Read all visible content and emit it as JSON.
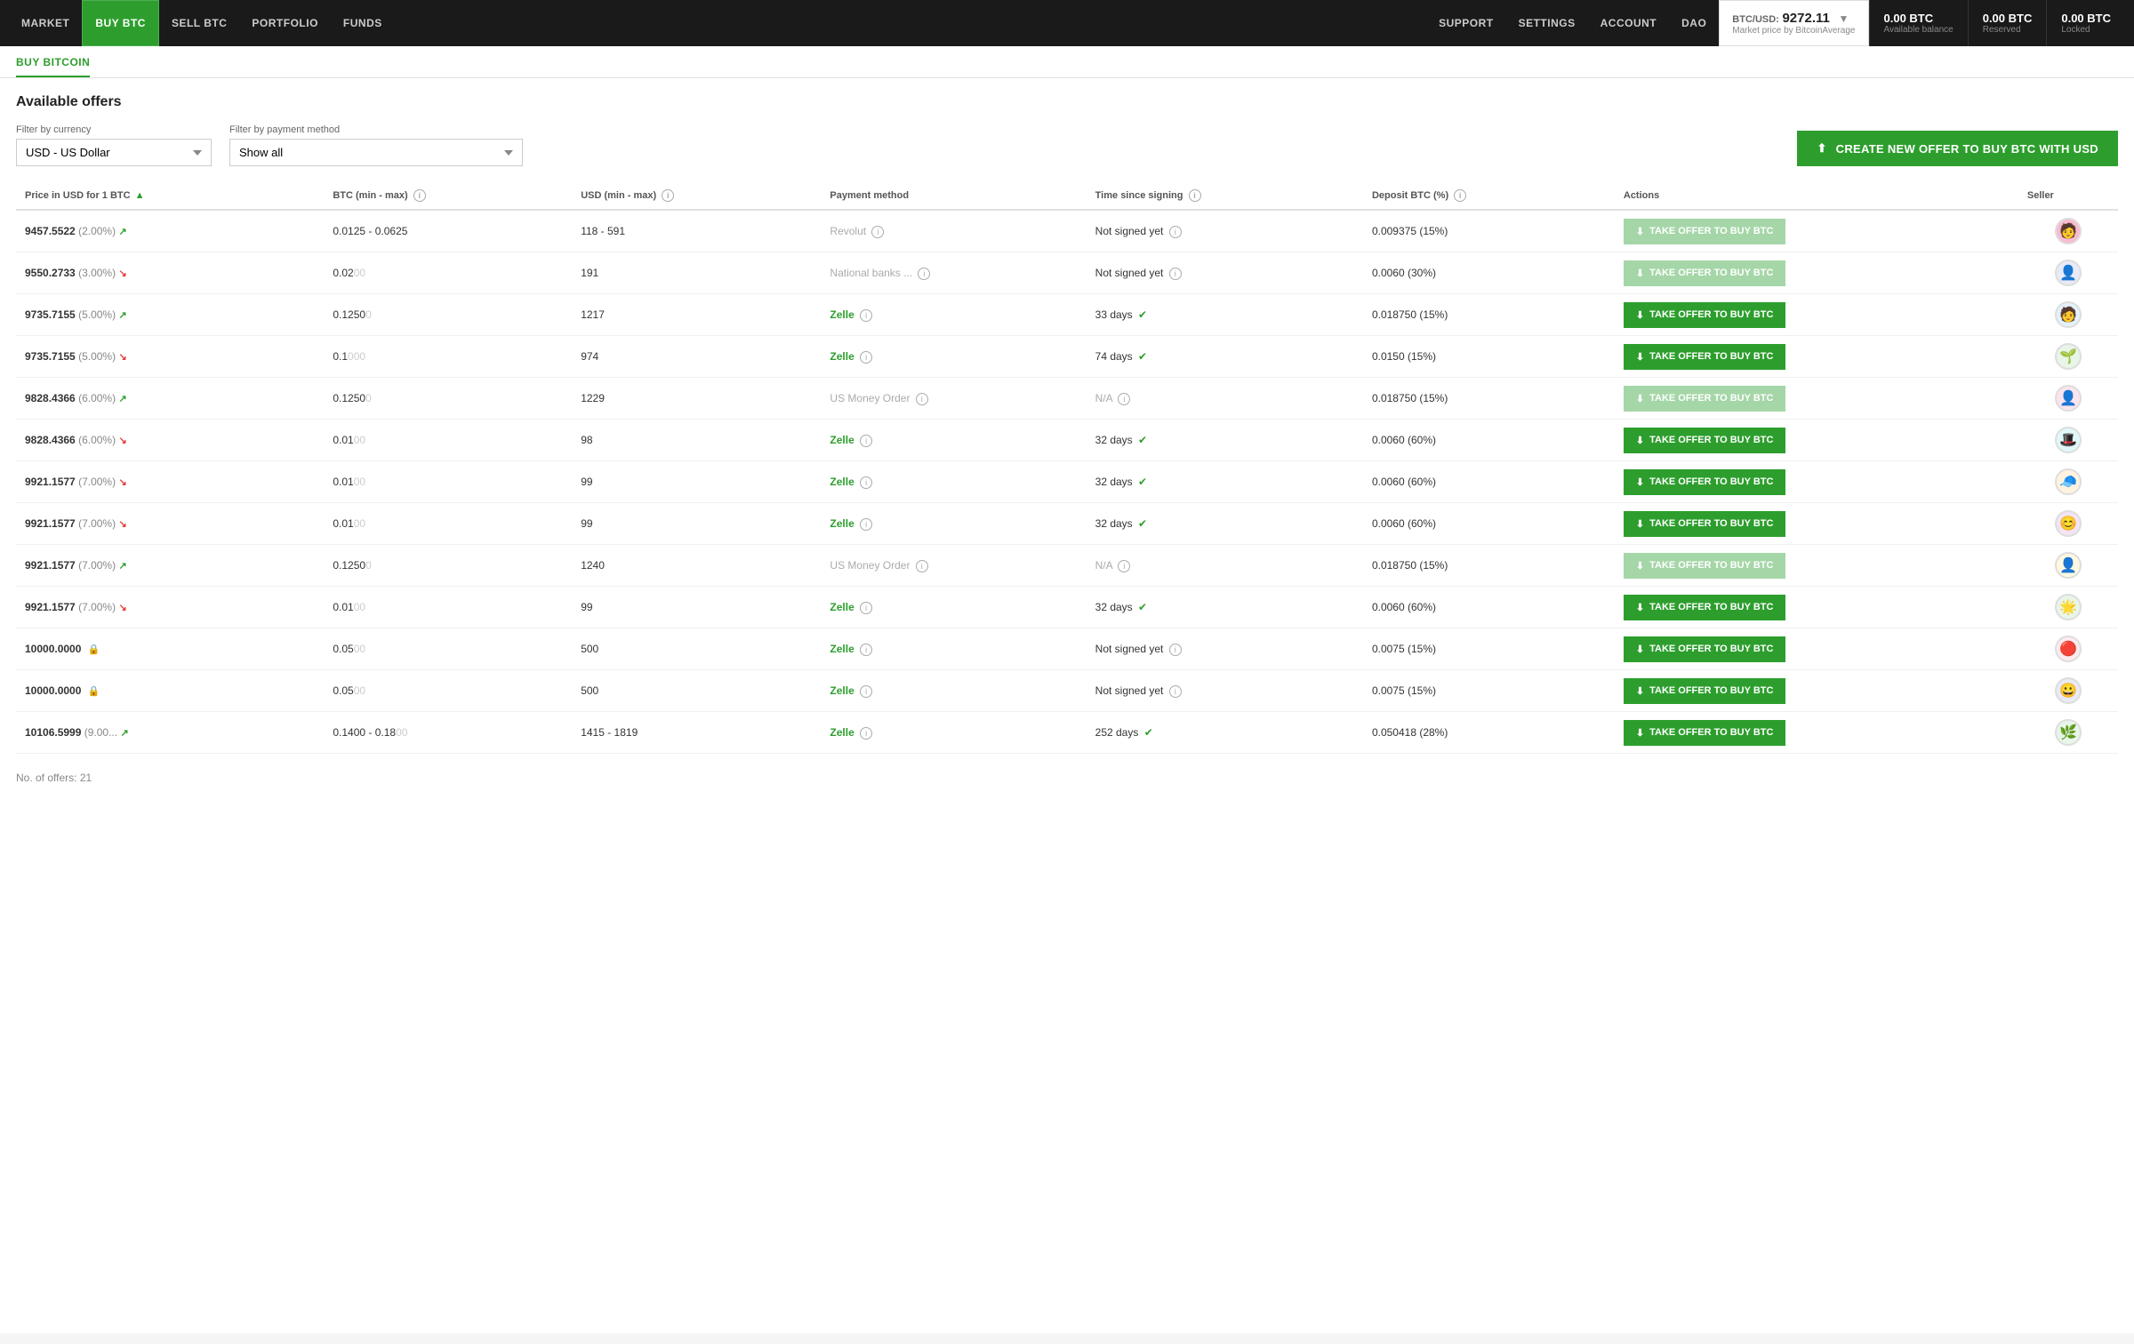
{
  "nav": {
    "items": [
      {
        "label": "MARKET",
        "active": false
      },
      {
        "label": "BUY BTC",
        "active": true
      },
      {
        "label": "SELL BTC",
        "active": false
      },
      {
        "label": "PORTFOLIO",
        "active": false
      },
      {
        "label": "FUNDS",
        "active": false
      }
    ],
    "right_items": [
      {
        "label": "Support"
      },
      {
        "label": "Settings"
      },
      {
        "label": "Account"
      },
      {
        "label": "DAO"
      }
    ],
    "price": {
      "pair": "BTC/USD:",
      "value": "9272.11",
      "sub": "Market price by BitcoinAverage",
      "chevron": "▼"
    },
    "balances": [
      {
        "value": "0.00 BTC",
        "label": "Available balance"
      },
      {
        "value": "0.00 BTC",
        "label": "Reserved"
      },
      {
        "value": "0.00 BTC",
        "label": "Locked"
      }
    ]
  },
  "page": {
    "breadcrumb": "BUY BITCOIN",
    "section_title": "Available offers"
  },
  "filters": {
    "currency_label": "Filter by currency",
    "currency_value": "USD  -  US Dollar",
    "payment_label": "Filter by payment method",
    "payment_value": "Show all",
    "create_btn": "CREATE NEW OFFER TO BUY BTC WITH USD"
  },
  "table": {
    "columns": [
      "Price in USD for 1 BTC",
      "BTC (min - max)",
      "USD (min - max)",
      "Payment method",
      "Time since signing",
      "Deposit BTC (%)",
      "Actions",
      "Seller"
    ],
    "rows": [
      {
        "price": "9457.5522",
        "pct": "(2.00%)",
        "trend": "up",
        "btc": "0.0125 - 0.0625",
        "usd": "118 - 591",
        "payment": "Revolut",
        "payment_active": false,
        "time": "Not signed yet",
        "time_verified": false,
        "deposit": "0.009375 (15%)",
        "btn_disabled": true,
        "avatar_emoji": "🧑",
        "avatar_color": "#f8bbd0"
      },
      {
        "price": "9550.2733",
        "pct": "(3.00%)",
        "trend": "down",
        "btc": "0.02",
        "btc_hidden": "00",
        "usd": "191",
        "payment": "National banks ...",
        "payment_active": false,
        "time": "Not signed yet",
        "time_verified": false,
        "deposit": "0.0060 (30%)",
        "btn_disabled": true,
        "avatar_emoji": "👤",
        "avatar_color": "#e8eaf6"
      },
      {
        "price": "9735.7155",
        "pct": "(5.00%)",
        "trend": "up",
        "btc": "0.1250",
        "btc_hidden": "0",
        "usd": "1217",
        "payment": "Zelle",
        "payment_active": true,
        "time": "33 days",
        "time_verified": true,
        "deposit": "0.018750 (15%)",
        "btn_disabled": false,
        "avatar_emoji": "🧑",
        "avatar_color": "#e3f2fd"
      },
      {
        "price": "9735.7155",
        "pct": "(5.00%)",
        "trend": "down",
        "btc": "0.1",
        "btc_hidden": "000",
        "usd": "974",
        "payment": "Zelle",
        "payment_active": true,
        "time": "74 days",
        "time_verified": true,
        "deposit": "0.0150 (15%)",
        "btn_disabled": false,
        "avatar_emoji": "🌱",
        "avatar_color": "#e8f5e9"
      },
      {
        "price": "9828.4366",
        "pct": "(6.00%)",
        "trend": "up",
        "btc": "0.1250",
        "btc_hidden": "0",
        "usd": "1229",
        "payment": "US Money Order",
        "payment_active": false,
        "time": "N/A",
        "time_verified": false,
        "time_na": true,
        "deposit": "0.018750 (15%)",
        "btn_disabled": true,
        "avatar_emoji": "👤",
        "avatar_color": "#fce4ec"
      },
      {
        "price": "9828.4366",
        "pct": "(6.00%)",
        "trend": "down",
        "btc": "0.01",
        "btc_hidden": "00",
        "usd": "98",
        "payment": "Zelle",
        "payment_active": true,
        "time": "32 days",
        "time_verified": true,
        "deposit": "0.0060 (60%)",
        "btn_disabled": false,
        "avatar_emoji": "🎩",
        "avatar_color": "#e0f7fa"
      },
      {
        "price": "9921.1577",
        "pct": "(7.00%)",
        "trend": "down",
        "btc": "0.01",
        "btc_hidden": "00",
        "usd": "99",
        "payment": "Zelle",
        "payment_active": true,
        "time": "32 days",
        "time_verified": true,
        "deposit": "0.0060 (60%)",
        "btn_disabled": false,
        "avatar_emoji": "🧢",
        "avatar_color": "#fff3e0"
      },
      {
        "price": "9921.1577",
        "pct": "(7.00%)",
        "trend": "down",
        "btc": "0.01",
        "btc_hidden": "00",
        "usd": "99",
        "payment": "Zelle",
        "payment_active": true,
        "time": "32 days",
        "time_verified": true,
        "deposit": "0.0060 (60%)",
        "btn_disabled": false,
        "avatar_emoji": "😊",
        "avatar_color": "#f3e5f5"
      },
      {
        "price": "9921.1577",
        "pct": "(7.00%)",
        "trend": "up",
        "btc": "0.1250",
        "btc_hidden": "0",
        "usd": "1240",
        "payment": "US Money Order",
        "payment_active": false,
        "time": "N/A",
        "time_verified": false,
        "time_na": true,
        "deposit": "0.018750 (15%)",
        "btn_disabled": true,
        "avatar_emoji": "👤",
        "avatar_color": "#fff8e1"
      },
      {
        "price": "9921.1577",
        "pct": "(7.00%)",
        "trend": "down",
        "btc": "0.01",
        "btc_hidden": "00",
        "usd": "99",
        "payment": "Zelle",
        "payment_active": true,
        "time": "32 days",
        "time_verified": true,
        "deposit": "0.0060 (60%)",
        "btn_disabled": false,
        "avatar_emoji": "🌟",
        "avatar_color": "#e8f5e9"
      },
      {
        "price": "10000.0000",
        "pct": "",
        "trend": "none",
        "locked": true,
        "btc": "0.05",
        "btc_hidden": "00",
        "usd": "500",
        "payment": "Zelle",
        "payment_active": true,
        "time": "Not signed yet",
        "time_verified": false,
        "deposit": "0.0075 (15%)",
        "btn_disabled": false,
        "avatar_emoji": "🔴",
        "avatar_color": "#ffebee"
      },
      {
        "price": "10000.0000",
        "pct": "",
        "trend": "none",
        "locked": true,
        "btc": "0.05",
        "btc_hidden": "00",
        "usd": "500",
        "payment": "Zelle",
        "payment_active": true,
        "time": "Not signed yet",
        "time_verified": false,
        "deposit": "0.0075 (15%)",
        "btn_disabled": false,
        "avatar_emoji": "😀",
        "avatar_color": "#e8eaf6"
      },
      {
        "price": "10106.5999",
        "pct": "(9.00...",
        "trend": "up",
        "btc": "0.1400 - 0.18",
        "btc_hidden": "00",
        "usd": "1415 - 1819",
        "payment": "Zelle",
        "payment_active": true,
        "time": "252 days",
        "time_verified": true,
        "deposit": "0.050418 (28%)",
        "btn_disabled": false,
        "avatar_emoji": "🌿",
        "avatar_color": "#e8f5e9"
      }
    ]
  },
  "footer": {
    "no_offers": "No. of offers: 21"
  },
  "icons": {
    "download": "⬇",
    "info": "i",
    "verified": "✔",
    "lock": "🔒",
    "chart_up": "↗",
    "chart_down": "↘",
    "upload": "⬆"
  }
}
